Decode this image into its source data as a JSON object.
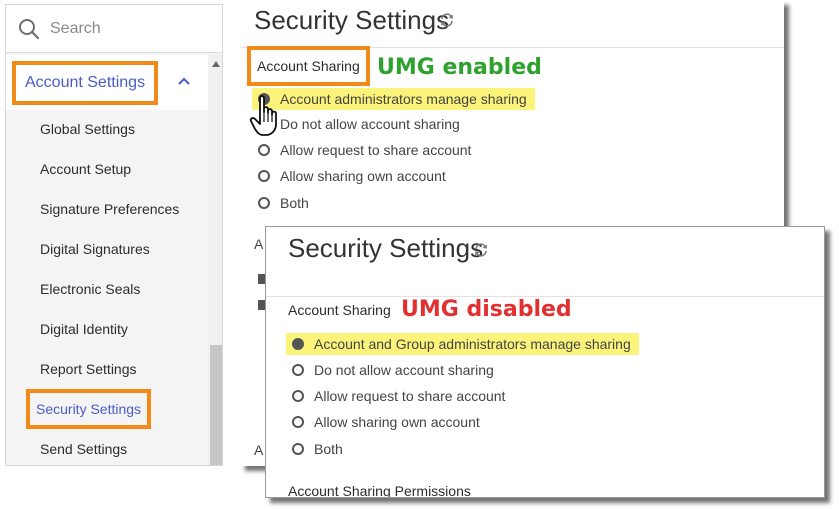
{
  "sidebar": {
    "search_placeholder": "Search",
    "section_label": "Account Settings",
    "items": [
      {
        "label": "Global Settings"
      },
      {
        "label": "Account Setup"
      },
      {
        "label": "Signature Preferences"
      },
      {
        "label": "Digital Signatures"
      },
      {
        "label": "Electronic Seals"
      },
      {
        "label": "Digital Identity"
      },
      {
        "label": "Report Settings"
      },
      {
        "label": "Security Settings",
        "active": true
      },
      {
        "label": "Send Settings"
      }
    ]
  },
  "panel_enabled": {
    "title": "Security Settings",
    "section_label": "Account Sharing",
    "annotation": "UMG enabled",
    "annotation_color": "#2ea12e",
    "options": [
      {
        "label": "Account administrators manage sharing",
        "checked": true
      },
      {
        "label": "Do not allow account sharing",
        "checked": false
      },
      {
        "label": "Allow request to share account",
        "checked": false
      },
      {
        "label": "Allow sharing own account",
        "checked": false
      },
      {
        "label": "Both",
        "checked": false
      }
    ],
    "truncated_letter": "A"
  },
  "panel_disabled": {
    "title": "Security Settings",
    "section_label": "Account Sharing",
    "annotation": "UMG disabled",
    "annotation_color": "#e23030",
    "options": [
      {
        "label": "Account and Group administrators manage sharing",
        "checked": true
      },
      {
        "label": "Do not allow account sharing",
        "checked": false
      },
      {
        "label": "Allow request to share account",
        "checked": false
      },
      {
        "label": "Allow sharing own account",
        "checked": false
      },
      {
        "label": "Both",
        "checked": false
      }
    ],
    "next_section_label": "Account Sharing Permissions"
  },
  "colors": {
    "accent": "#4a5cc8",
    "callout_border": "#f28a19",
    "highlight": "#fbf37a"
  },
  "icons": [
    "search-icon",
    "chevron-up-icon",
    "refresh-icon",
    "hand-cursor-icon"
  ]
}
